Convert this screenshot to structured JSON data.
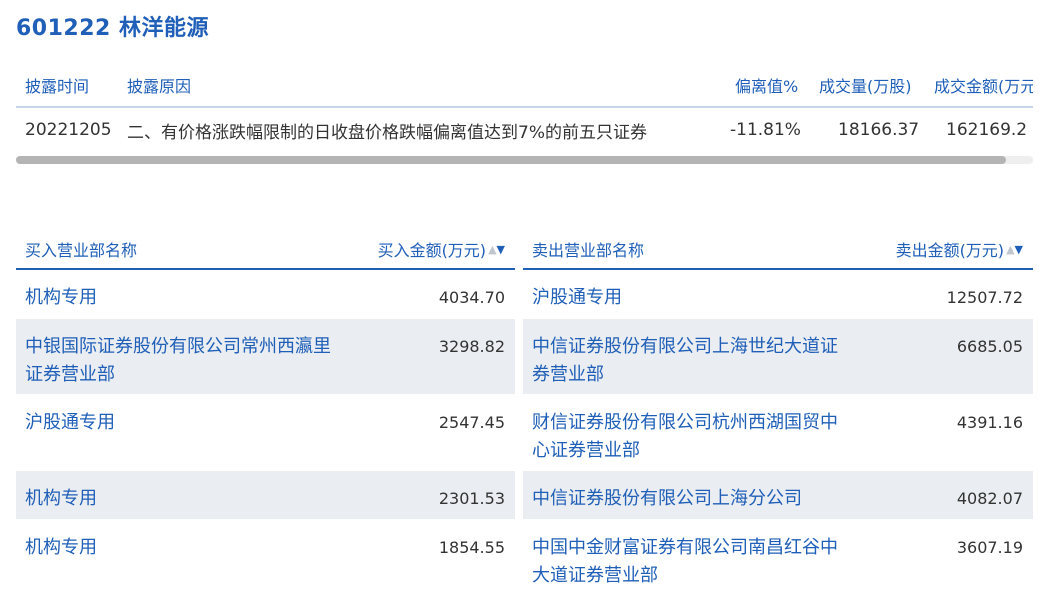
{
  "stock": {
    "title": "601222 林洋能源"
  },
  "disclosure": {
    "headers": {
      "date": "披露时间",
      "reason": "披露原因",
      "deviation": "偏离值%",
      "volume": "成交量(万股)",
      "amount": "成交金额(万元"
    },
    "row": {
      "date": "20221205",
      "reason": "二、有价格涨跌幅限制的日收盘价格跌幅偏离值达到7%的前五只证券",
      "deviation": "-11.81%",
      "volume": "18166.37",
      "amount": "162169.2"
    }
  },
  "buy": {
    "header_name": "买入营业部名称",
    "header_amount": "买入金额(万元)",
    "rows": [
      {
        "name": "机构专用",
        "amount": "4034.70"
      },
      {
        "name": "中银国际证券股份有限公司常州西瀛里证券营业部",
        "amount": "3298.82"
      },
      {
        "name": "沪股通专用",
        "amount": "2547.45"
      },
      {
        "name": "机构专用",
        "amount": "2301.53"
      },
      {
        "name": "机构专用",
        "amount": "1854.55"
      }
    ]
  },
  "sell": {
    "header_name": "卖出营业部名称",
    "header_amount": "卖出金额(万元)",
    "rows": [
      {
        "name": "沪股通专用",
        "amount": "12507.72"
      },
      {
        "name": "中信证券股份有限公司上海世纪大道证券营业部",
        "amount": "6685.05"
      },
      {
        "name": "财信证券股份有限公司杭州西湖国贸中心证券营业部",
        "amount": "4391.16"
      },
      {
        "name": "中信证券股份有限公司上海分公司",
        "amount": "4082.07"
      },
      {
        "name": "中国中金财富证券有限公司南昌红谷中大道证券营业部",
        "amount": "3607.19"
      }
    ]
  },
  "icons": {
    "sort": "sort-up-down-icon"
  },
  "colors": {
    "accent": "#1f5fb8",
    "row_stripe": "#eaedf1"
  }
}
